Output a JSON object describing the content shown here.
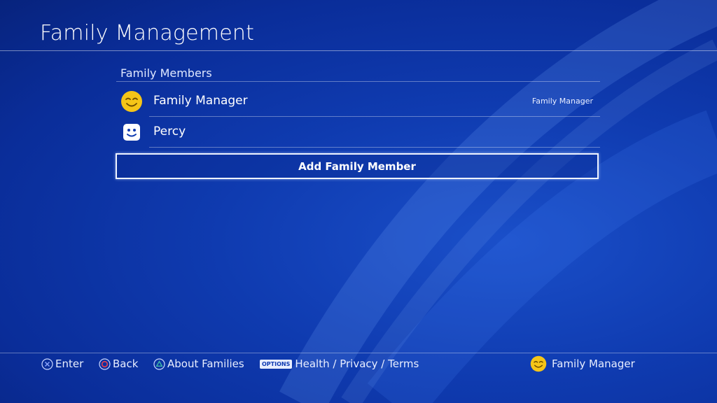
{
  "header": {
    "title": "Family Management"
  },
  "members_section": {
    "title": "Family Members",
    "members": [
      {
        "name": "Family Manager",
        "role": "Family Manager",
        "avatar": "smiley-yellow-avatar"
      },
      {
        "name": "Percy",
        "role": "",
        "avatar": "smiley-white-avatar"
      }
    ],
    "add_button_label": "Add Family Member"
  },
  "footer": {
    "hints": [
      {
        "button": "cross-button-icon",
        "label": "Enter"
      },
      {
        "button": "circle-button-icon",
        "label": "Back"
      },
      {
        "button": "triangle-button-icon",
        "label": "About Families"
      },
      {
        "button": "options-button-icon",
        "badge": "OPTIONS",
        "label": "Health / Privacy / Terms"
      }
    ],
    "current_user": "Family Manager"
  },
  "colors": {
    "background": "#0f3bb0",
    "accent_yellow": "#f5c518",
    "circle_red": "#e4414f",
    "triangle_green": "#3fb9a6",
    "cross_blue": "#8fa8ff"
  }
}
